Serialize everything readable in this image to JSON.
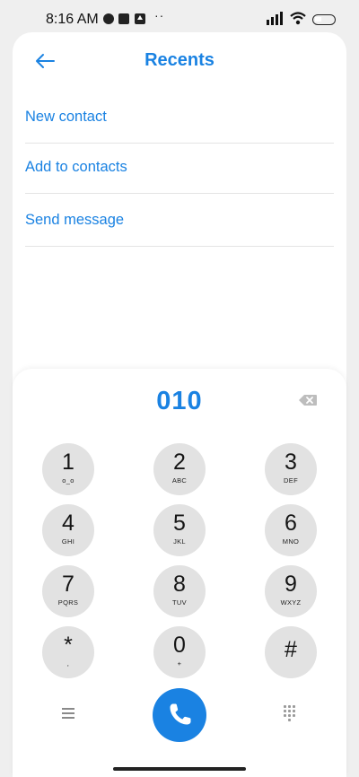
{
  "status_bar": {
    "time": "8:16 AM",
    "overflow_dots": "··"
  },
  "header": {
    "title": "Recents"
  },
  "menu": [
    {
      "label": "New contact"
    },
    {
      "label": "Add to contacts"
    },
    {
      "label": "Send message"
    }
  ],
  "dialer": {
    "number": "010",
    "keys": [
      {
        "digit": "1",
        "letters": "o_o"
      },
      {
        "digit": "2",
        "letters": "ABC"
      },
      {
        "digit": "3",
        "letters": "DEF"
      },
      {
        "digit": "4",
        "letters": "GHI"
      },
      {
        "digit": "5",
        "letters": "JKL"
      },
      {
        "digit": "6",
        "letters": "MNO"
      },
      {
        "digit": "7",
        "letters": "PQRS"
      },
      {
        "digit": "8",
        "letters": "TUV"
      },
      {
        "digit": "9",
        "letters": "WXYZ"
      },
      {
        "digit": "*",
        "letters": ","
      },
      {
        "digit": "0",
        "letters": "+"
      },
      {
        "digit": "#",
        "letters": ""
      }
    ]
  },
  "colors": {
    "accent": "#1a82e2",
    "key_bg": "#e2e2e2",
    "page_bg": "#efefef"
  },
  "icons": [
    "back-arrow-icon",
    "backspace-icon",
    "menu-lines-icon",
    "phone-icon",
    "dialpad-grid-icon"
  ]
}
